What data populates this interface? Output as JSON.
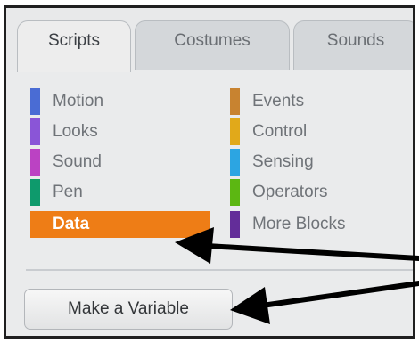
{
  "tabs": {
    "scripts": "Scripts",
    "costumes": "Costumes",
    "sounds": "Sounds"
  },
  "categories": {
    "motion": {
      "label": "Motion",
      "color": "#4a6cd4"
    },
    "looks": {
      "label": "Looks",
      "color": "#8a55d7"
    },
    "sound": {
      "label": "Sound",
      "color": "#bb42c3"
    },
    "pen": {
      "label": "Pen",
      "color": "#0e9a6c"
    },
    "data": {
      "label": "Data",
      "color": "#ee7d16"
    },
    "events": {
      "label": "Events",
      "color": "#c88330"
    },
    "control": {
      "label": "Control",
      "color": "#e1a91a"
    },
    "sensing": {
      "label": "Sensing",
      "color": "#2ca5e2"
    },
    "operators": {
      "label": "Operators",
      "color": "#5cb712"
    },
    "more_blocks": {
      "label": "More Blocks",
      "color": "#632d99"
    }
  },
  "selected_category": "Data",
  "make_variable_label": "Make a Variable",
  "colors": {
    "annotation_arrow": "#000000",
    "selected_bg": "#ee7d16"
  }
}
